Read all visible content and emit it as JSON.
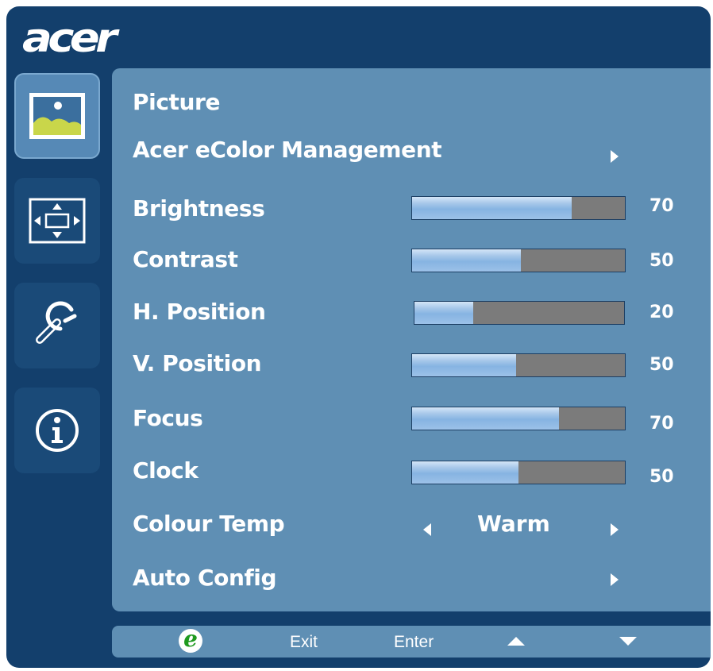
{
  "brand": {
    "logo_text": "acer"
  },
  "sidebar": {
    "tabs": [
      {
        "icon": "picture-icon",
        "active": true
      },
      {
        "icon": "position-icon",
        "active": false
      },
      {
        "icon": "settings-wrench-icon",
        "active": false
      },
      {
        "icon": "info-icon",
        "active": false
      }
    ]
  },
  "menu": {
    "title": "Picture",
    "ecolor": {
      "label": "Acer eColor Management"
    },
    "brightness": {
      "label": "Brightness",
      "value": "70",
      "level": 0.75
    },
    "contrast": {
      "label": "Contrast",
      "value": "50",
      "level": 0.51
    },
    "hposition": {
      "label": "H. Position",
      "value": "20",
      "level": 0.28
    },
    "vposition": {
      "label": "V. Position",
      "value": "50",
      "level": 0.49
    },
    "focus": {
      "label": "Focus",
      "value": "70",
      "level": 0.69
    },
    "clock": {
      "label": "Clock",
      "value": "50",
      "level": 0.5
    },
    "colour_temp": {
      "label": "Colour Temp",
      "value": "Warm"
    },
    "auto_config": {
      "label": "Auto Config"
    }
  },
  "bottom_bar": {
    "e_key": "e",
    "exit_label": "Exit",
    "enter_label": "Enter"
  },
  "colors": {
    "frame": "#133f6c",
    "panel": "#5f8fb4",
    "bar_fill": "#a8c8ea",
    "bar_empty": "#7b7b7b",
    "e_key_green": "#1f9a1f"
  }
}
